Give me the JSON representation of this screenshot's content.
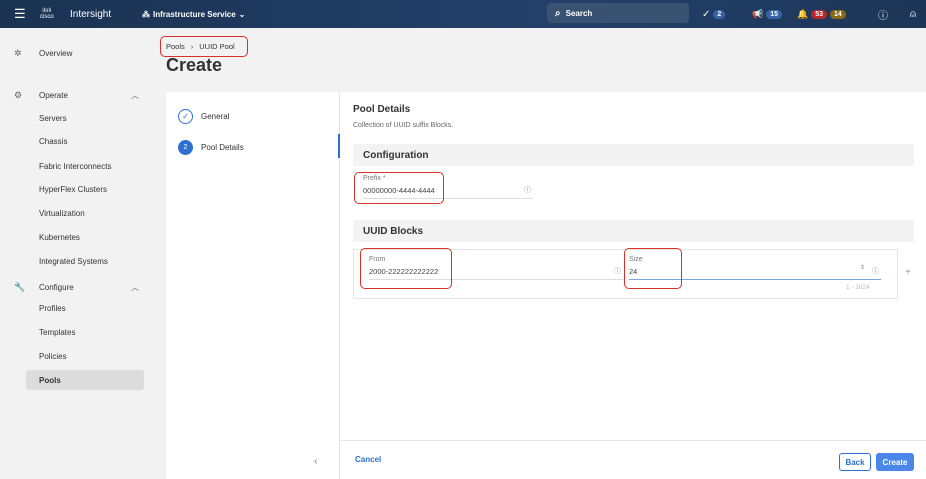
{
  "topbar": {
    "app": "Intersight",
    "logo": "cisco",
    "service": "Infrastructure Service",
    "search": "Search",
    "tasks_count": "2",
    "announcements_count": "15",
    "alarms_critical": "53",
    "alarms_warning": "14"
  },
  "sidebar": {
    "overview": "Overview",
    "operate": "Operate",
    "operate_items": [
      "Servers",
      "Chassis",
      "Fabric Interconnects",
      "HyperFlex Clusters",
      "Virtualization",
      "Kubernetes",
      "Integrated Systems"
    ],
    "configure": "Configure",
    "configure_items": [
      "Profiles",
      "Templates",
      "Policies",
      "Pools"
    ]
  },
  "breadcrumb": {
    "root": "Pools",
    "current": "UUID Pool"
  },
  "page_title": "Create",
  "steps": [
    {
      "num": "1",
      "label": "General"
    },
    {
      "num": "2",
      "label": "Pool Details"
    }
  ],
  "main": {
    "title": "Pool Details",
    "subtitle": "Collection of UUID suffix Blocks.",
    "configuration": "Configuration",
    "prefix_label": "Prefix *",
    "prefix_value": "00000000-4444-4444",
    "blocks_title": "UUID Blocks",
    "from_label": "From",
    "from_value": "2000-222222222222",
    "size_label": "Size",
    "size_value": "24",
    "size_range": "1 - 1024"
  },
  "footer": {
    "cancel": "Cancel",
    "back": "Back",
    "create": "Create"
  },
  "colors": {
    "accent": "#4a87e8",
    "highlight": "#d9312a"
  }
}
